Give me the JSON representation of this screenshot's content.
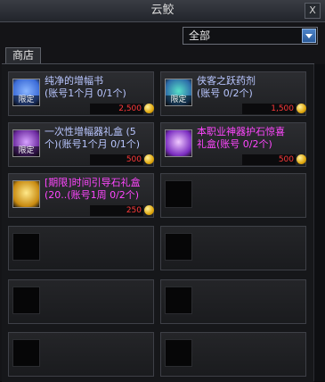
{
  "window": {
    "title": "云鲛",
    "close_glyph": "X"
  },
  "filter": {
    "selected": "全部"
  },
  "tabs": [
    {
      "label": "商店"
    }
  ],
  "items": [
    {
      "name": "纯净的增幅书\n(账号1个月 0/1个)",
      "price": "2,500",
      "badge": "限定",
      "name_color": "#b9c6ff",
      "icon_colors": [
        "#3c6cd8",
        "#8ab6ff"
      ]
    },
    {
      "name": "侠客之跃药剂\n(账号 0/2个)",
      "price": "1,500",
      "badge": "限定",
      "name_color": "#b9c6ff",
      "icon_colors": [
        "#2c6aa8",
        "#58e0c8"
      ]
    },
    {
      "name": "一次性增幅器礼盒 (5\n个)(账号1个月 0/1个)",
      "price": "500",
      "badge": "限定",
      "name_color": "#b9c6ff",
      "icon_colors": [
        "#6c2aa0",
        "#d7a2ff"
      ]
    },
    {
      "name": "本职业神器护石惊喜\n礼盒(账号 0/2个)",
      "price": "500",
      "badge": "",
      "name_color": "#ff47ff",
      "icon_colors": [
        "#7a2cc0",
        "#f0c8ff"
      ]
    },
    {
      "name": "[期限]时间引导石礼盒\n(20..(账号1周 0/2个)",
      "price": "250",
      "badge": "",
      "name_color": "#ff47ff",
      "icon_colors": [
        "#c88a10",
        "#ffe98a"
      ]
    }
  ],
  "colors": {
    "price": "#ff3a3a",
    "accent": "#4e84c9"
  }
}
